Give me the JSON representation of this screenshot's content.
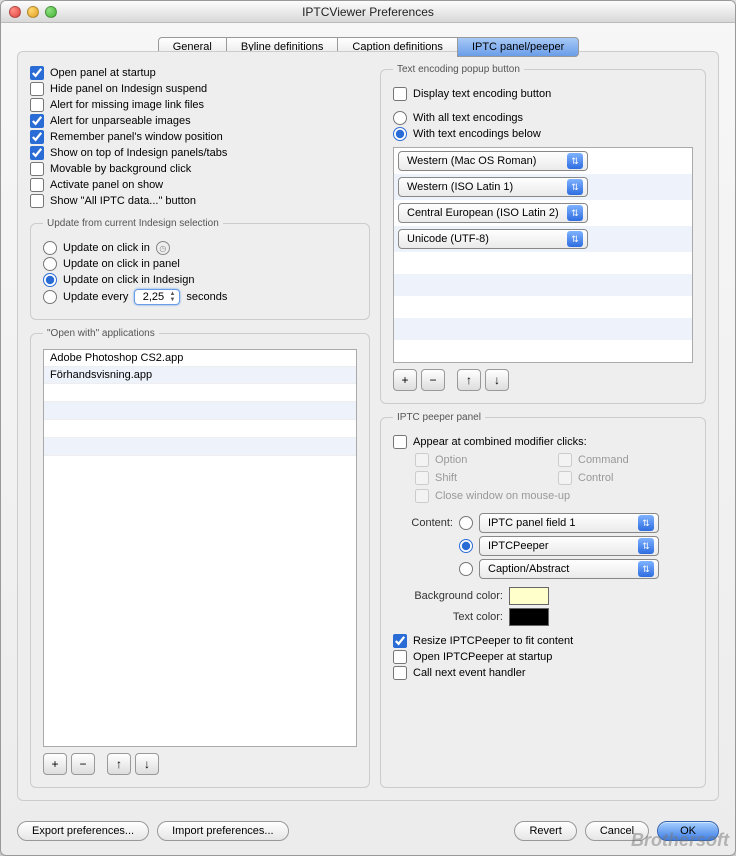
{
  "window": {
    "title": "IPTCViewer Preferences"
  },
  "tabs": [
    "General",
    "Byline definitions",
    "Caption definitions",
    "IPTC panel/peeper"
  ],
  "activeTab": 3,
  "leftChecks": [
    {
      "label": "Open panel at startup",
      "checked": true
    },
    {
      "label": "Hide panel on Indesign suspend",
      "checked": false
    },
    {
      "label": "Alert for missing image link files",
      "checked": false
    },
    {
      "label": "Alert for unparseable images",
      "checked": true
    },
    {
      "label": "Remember panel's window position",
      "checked": true
    },
    {
      "label": "Show on top of Indesign panels/tabs",
      "checked": true
    },
    {
      "label": "Movable by background click",
      "checked": false
    },
    {
      "label": "Activate panel on show",
      "checked": false
    },
    {
      "label": "Show \"All IPTC data...\" button",
      "checked": false
    }
  ],
  "updateGroup": {
    "legend": "Update from current Indesign selection",
    "options": [
      {
        "label": "Update on click in",
        "clock": true
      },
      {
        "label": "Update on click in panel"
      },
      {
        "label": "Update on click in Indesign"
      },
      {
        "label": "Update every",
        "value": "2,25",
        "suffix": "seconds"
      }
    ],
    "selected": 2
  },
  "openWith": {
    "legend": "\"Open with\" applications",
    "items": [
      "Adobe Photoshop CS2.app",
      "Förhandsvisning.app"
    ]
  },
  "encoding": {
    "legend": "Text encoding popup button",
    "displayCheck": "Display text encoding button",
    "displayChecked": false,
    "radios": [
      "With all text encodings",
      "With text encodings below"
    ],
    "radioSelected": 1,
    "items": [
      "Western (Mac OS Roman)",
      "Western (ISO Latin 1)",
      "Central European (ISO Latin 2)",
      "Unicode (UTF-8)"
    ]
  },
  "peeper": {
    "legend": "IPTC peeper panel",
    "appear": {
      "label": "Appear at combined modifier clicks:",
      "checked": false
    },
    "mods": [
      "Option",
      "Command",
      "Shift",
      "Control"
    ],
    "closeLabel": "Close window on mouse-up",
    "contentLabel": "Content:",
    "contentSelected": 1,
    "contentOptions": [
      "IPTC panel field 1",
      "IPTCPeeper",
      "Caption/Abstract"
    ],
    "bgLabel": "Background color:",
    "bgColor": "#ffffcc",
    "textLabel": "Text color:",
    "textColor": "#000000",
    "resize": {
      "label": "Resize IPTCPeeper to fit content",
      "checked": true
    },
    "openStart": {
      "label": "Open IPTCPeeper at startup",
      "checked": false
    },
    "callNext": {
      "label": "Call next event handler",
      "checked": false
    }
  },
  "buttons": {
    "export": "Export preferences...",
    "import": "Import preferences...",
    "revert": "Revert",
    "cancel": "Cancel",
    "ok": "OK"
  },
  "listButtons": {
    "add": "+",
    "remove": "−",
    "up": "↑",
    "down": "↓"
  },
  "watermark": "Brothersoft"
}
